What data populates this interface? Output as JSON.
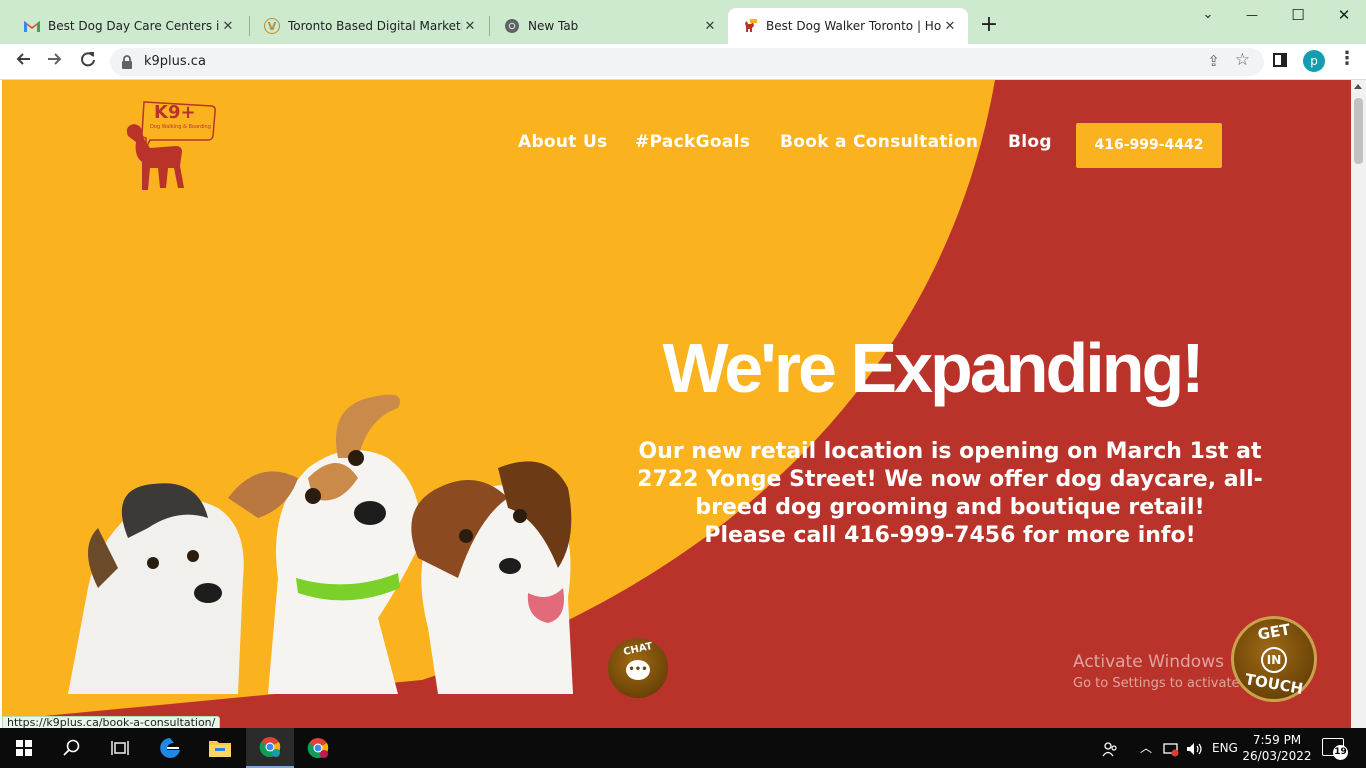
{
  "browser": {
    "tabs": [
      {
        "title": "Best Dog Day Care Centers in Tor",
        "favicon": "gmail-icon",
        "active": false
      },
      {
        "title": "Toronto Based Digital Marketing",
        "favicon": "marketing-site-icon",
        "active": false
      },
      {
        "title": "New Tab",
        "favicon": "chrome-icon",
        "active": false
      },
      {
        "title": "Best Dog Walker Toronto | Home",
        "favicon": "k9plus-icon",
        "active": true
      }
    ],
    "new_tab_symbol": "+",
    "window_controls": {
      "minimize": "—",
      "maximize": "☐",
      "close": "✕",
      "dropdown": "⌄"
    },
    "address": "k9plus.ca",
    "profile_initial": "p",
    "status_url": "https://k9plus.ca/book-a-consultation/"
  },
  "site": {
    "logo_text": "K9+",
    "logo_tagline": "Dog Walking & Boarding",
    "nav": [
      "About Us",
      "#PackGoals",
      "Book a Consultation",
      "Blog"
    ],
    "phone_cta": "416-999-4442",
    "headline": "We're Expanding!",
    "subtext": [
      "Our new retail location is opening on March 1st at",
      "2722 Yonge Street! We now offer dog daycare, all-",
      "breed dog grooming and boutique retail!",
      "Please call 416-999-7456 for more info!"
    ],
    "chat_label": "CHAT",
    "get_in_touch": {
      "top": "GET",
      "middle": "IN",
      "bottom": "TOUCH"
    },
    "colors": {
      "yellow": "#fbb21f",
      "red": "#b9332a",
      "white": "#ffffff"
    }
  },
  "watermark": {
    "line1": "Activate Windows",
    "line2": "Go to Settings to activate Windows."
  },
  "taskbar": {
    "lang": "ENG",
    "time": "7:59 PM",
    "date": "26/03/2022",
    "notification_count": "19"
  }
}
